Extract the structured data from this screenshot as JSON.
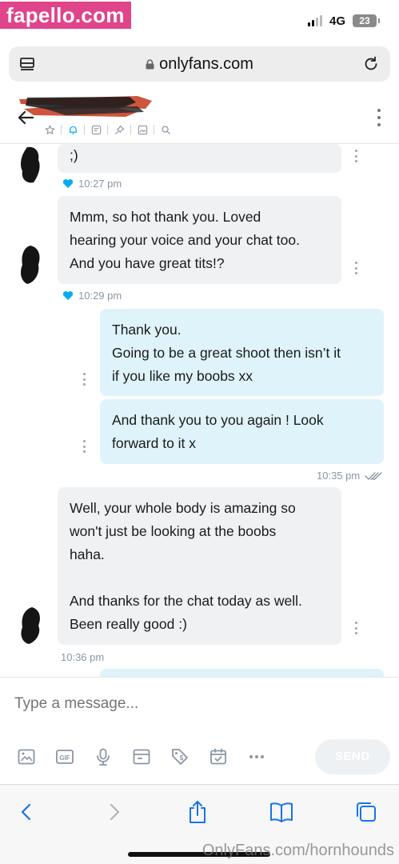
{
  "status_bar": {
    "watermark": "fapello.com",
    "network": "4G",
    "battery": "23"
  },
  "browser": {
    "url": "onlyfans.com"
  },
  "chat": {
    "messages": [
      {
        "side": "in",
        "text": ";)",
        "time": "10:27 pm",
        "liked": true
      },
      {
        "side": "in",
        "text": "Mmm, so hot thank you. Loved\nhearing your voice and your chat too.\nAnd you have great tits!?",
        "time": "10:29 pm",
        "liked": true
      },
      {
        "side": "out",
        "text": "Thank you.\nGoing to be a great shoot then isn’t it\nif you like my boobs xx"
      },
      {
        "side": "out",
        "text": "And thank you to you again ! Look\nforward to it x",
        "time": "10:35 pm",
        "read": true
      },
      {
        "side": "in",
        "text": "Well, your whole body is amazing so\nwon't just be looking at the boobs\nhaha.\n\nAnd thanks for the chat today as well.\nBeen really good :)",
        "time": "10:36 pm"
      }
    ]
  },
  "compose": {
    "placeholder": "Type a message...",
    "send_label": "SEND",
    "tools": [
      "image-icon",
      "gif-icon",
      "microphone-icon",
      "vault-icon",
      "price-tag-icon",
      "schedule-icon",
      "more-icon"
    ]
  },
  "credit": "OnlyFans.com/hornhounds",
  "colors": {
    "accent": "#00aff0",
    "incoming_bubble": "#eff1f3",
    "outgoing_bubble": "#dff3fb",
    "meta": "#8a96a3",
    "browser_blue": "#1a73e8"
  }
}
